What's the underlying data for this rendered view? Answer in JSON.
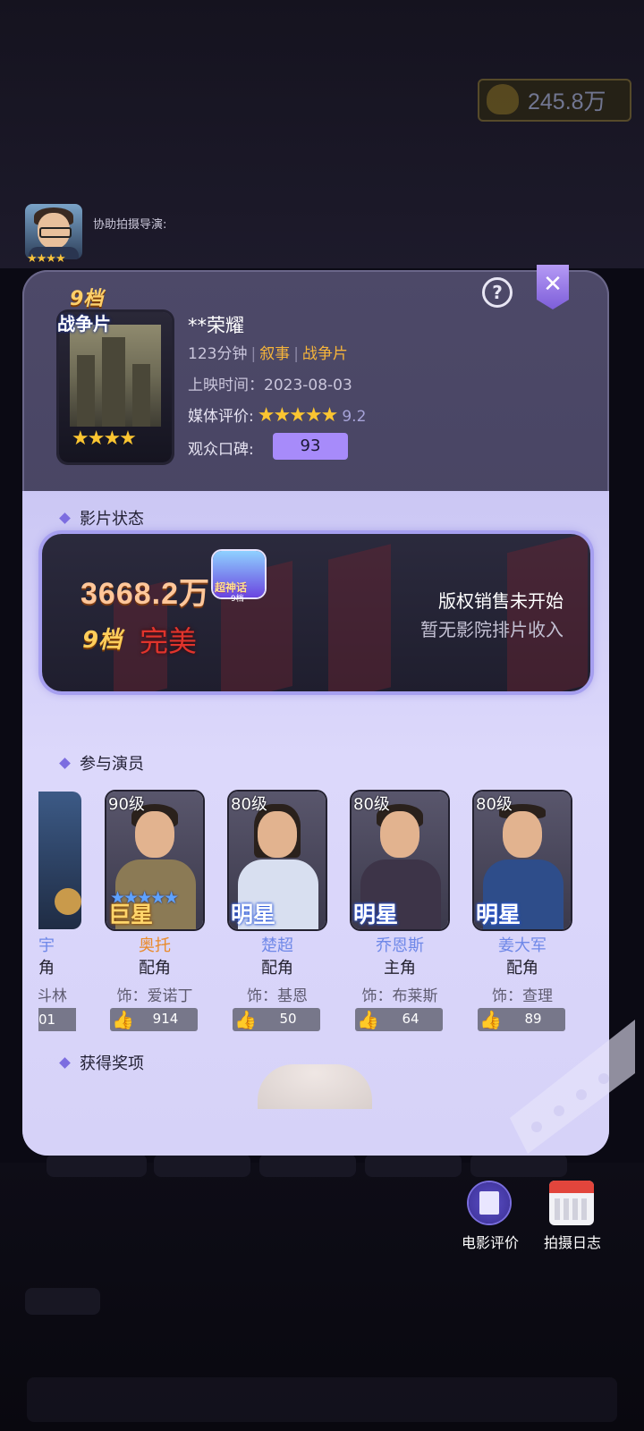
{
  "background": {
    "coins": "245.8万"
  },
  "director": {
    "label": "协助拍摄导演:",
    "stars": "★★★★"
  },
  "movie": {
    "tier": "9档",
    "genre": "战争片",
    "poster_stars": "★★★★",
    "title": "**荣耀",
    "duration": "123分钟",
    "tag1": "叙事",
    "tag2": "战争片",
    "release": "上映时间：2023-08-03",
    "media_label": "媒体评价:",
    "media_stars": "★★★★★",
    "media_score": "9.2",
    "audience_label": "观众口碑:",
    "audience_score": "93"
  },
  "status_section": {
    "heading": "影片状态",
    "box_office": "3668.2万",
    "badge_title": "超神话",
    "badge_sub": "9档",
    "tier": "9档",
    "grade": "完美",
    "copyright": "版权销售未开始",
    "cinema": "暂无影院排片收入"
  },
  "cast_section": {
    "heading": "参与演员",
    "partial": {
      "name": "宇",
      "role": "角",
      "char": "斗林",
      "likes": "01"
    },
    "actors": [
      {
        "level": "90级",
        "rank": "巨星",
        "name": "奥托",
        "role": "配角",
        "char": "饰：爱诺丁",
        "likes": "914"
      },
      {
        "level": "80级",
        "rank": "明星",
        "name": "楚超",
        "role": "配角",
        "char": "饰：基恩",
        "likes": "50"
      },
      {
        "level": "80级",
        "rank": "明星",
        "name": "乔恩斯",
        "role": "主角",
        "char": "饰：布莱斯",
        "likes": "64"
      },
      {
        "level": "80级",
        "rank": "明星",
        "name": "姜大军",
        "role": "配角",
        "char": "饰：查理",
        "likes": "89"
      }
    ]
  },
  "awards_section": {
    "heading": "获得奖项"
  },
  "bottom_actions": {
    "review": "电影评价",
    "log": "拍摄日志"
  },
  "colors": {
    "accent": "#a78bfa",
    "gold": "#f6b43a",
    "perfect": "#e0342c"
  }
}
